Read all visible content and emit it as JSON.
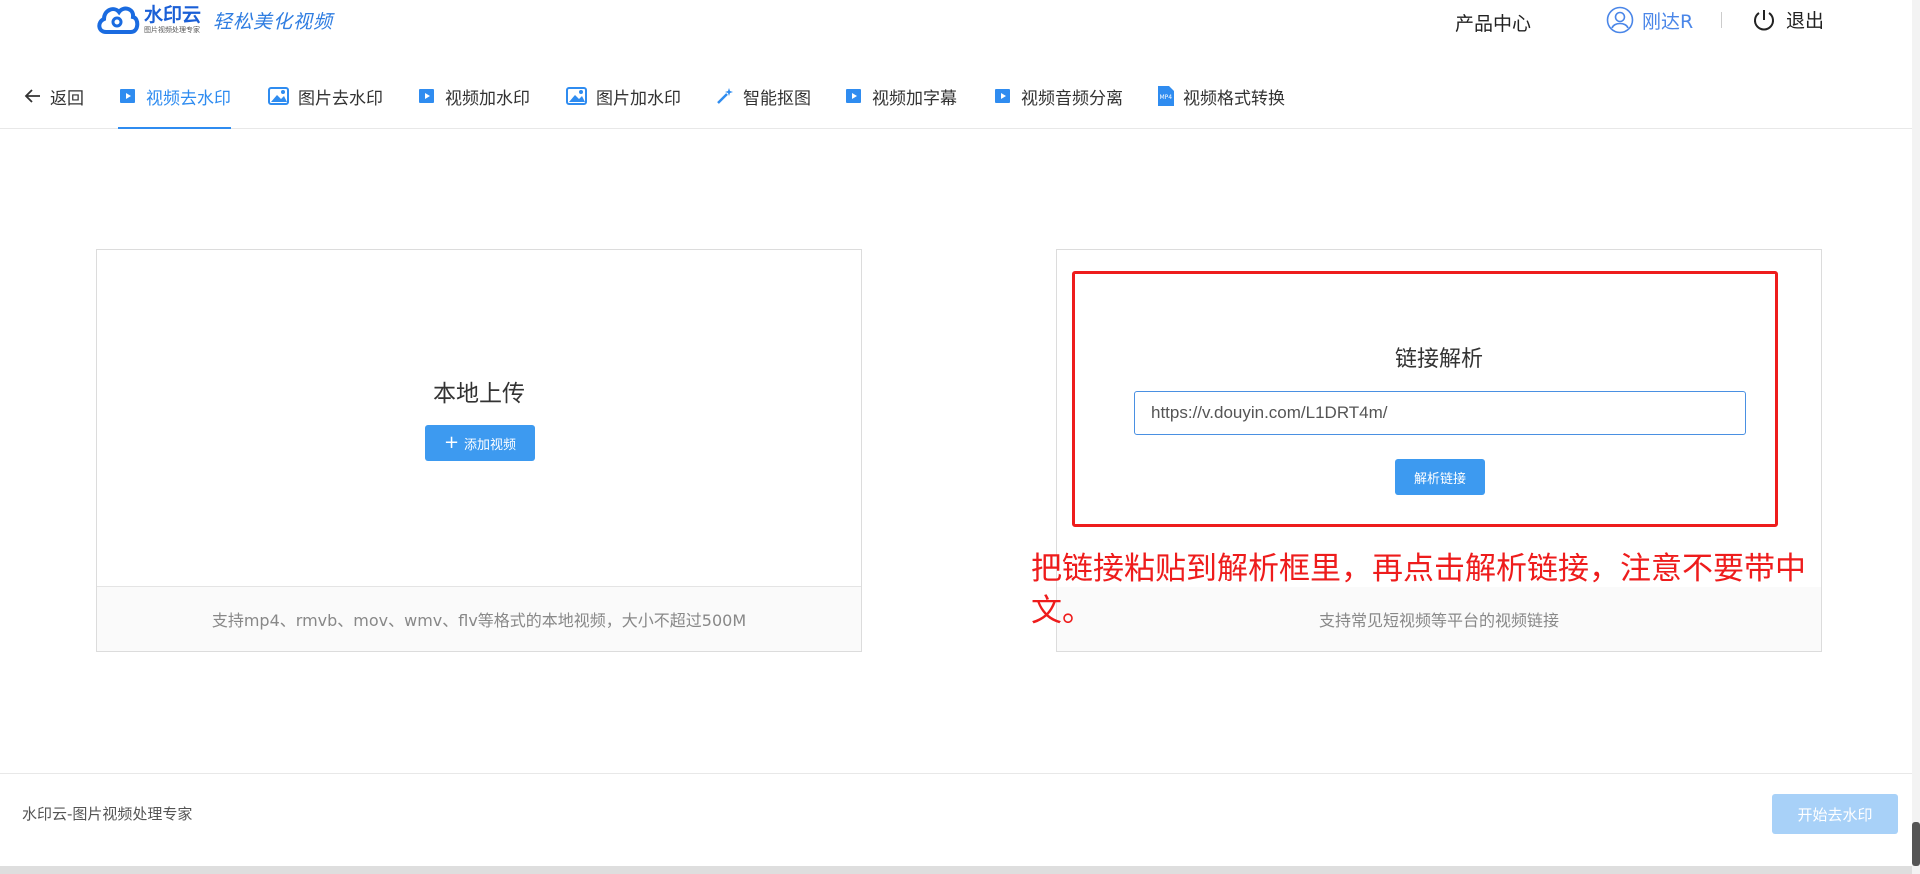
{
  "header": {
    "logo_name": "水印云",
    "logo_sub": "图片视频处理专家",
    "slogan": "轻松美化视频",
    "product_center": "产品中心",
    "username": "刚达R",
    "logout": "退出"
  },
  "nav": {
    "back": "返回",
    "tabs": [
      {
        "label": "视频去水印",
        "icon": "video-icon",
        "active": true
      },
      {
        "label": "图片去水印",
        "icon": "image-icon"
      },
      {
        "label": "视频加水印",
        "icon": "video-icon"
      },
      {
        "label": "图片加水印",
        "icon": "image-icon"
      },
      {
        "label": "智能抠图",
        "icon": "magic-wand-icon"
      },
      {
        "label": "视频加字幕",
        "icon": "video-icon"
      },
      {
        "label": "视频音频分离",
        "icon": "video-icon"
      },
      {
        "label": "视频格式转换",
        "icon": "mp4-file-icon"
      }
    ]
  },
  "local_upload": {
    "title": "本地上传",
    "button": "添加视频",
    "hint": "支持mp4、rmvb、mov、wmv、flv等格式的本地视频，大小不超过500M"
  },
  "link_parse": {
    "title": "链接解析",
    "input_value": "https://v.douyin.com/L1DRT4m/",
    "button": "解析链接",
    "hint": "支持常见短视频等平台的视频链接"
  },
  "annotation": "把链接粘贴到解析框里，再点击解析链接，注意不要带中文。",
  "footer": {
    "text": "水印云-图片视频处理专家",
    "start_button": "开始去水印"
  },
  "colors": {
    "accent": "#2f8cf0",
    "button": "#3d9af0",
    "disabled_button": "#a8d1f8",
    "annotation_red": "#ee1c1c"
  }
}
